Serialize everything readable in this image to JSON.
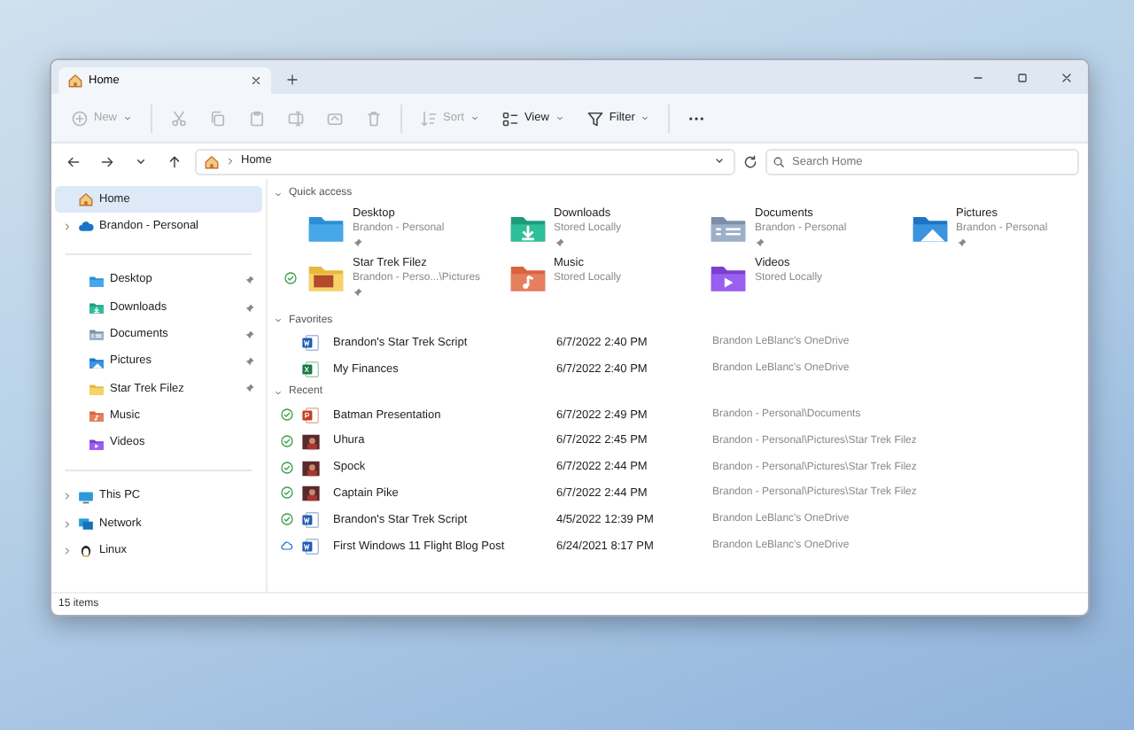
{
  "window": {
    "tab": {
      "title": "Home",
      "selected": true
    }
  },
  "toolbar": [
    {
      "label": "New",
      "kind": "new",
      "disabled": true
    },
    {
      "kind": "cut",
      "disabled": true
    },
    {
      "kind": "copy",
      "disabled": true
    },
    {
      "kind": "paste",
      "disabled": true
    },
    {
      "kind": "rename",
      "disabled": true
    },
    {
      "kind": "share",
      "disabled": true
    },
    {
      "kind": "delete",
      "disabled": true
    },
    {
      "label": "Sort",
      "kind": "sort",
      "disabled": true
    },
    {
      "label": "View",
      "kind": "view",
      "disabled": false
    },
    {
      "label": "Filter",
      "kind": "filter",
      "disabled": false
    },
    {
      "kind": "more",
      "disabled": false
    }
  ],
  "address": {
    "path": "Home",
    "search_placeholder": "Search Home"
  },
  "sidebar": {
    "top": [
      {
        "label": "Home",
        "kind": "home",
        "selected": true
      },
      {
        "label": "Brandon - Personal",
        "kind": "cloud",
        "selected": false,
        "expanded": false
      }
    ],
    "pinned": [
      {
        "label": "Desktop",
        "kind": "desktop",
        "pinned": true,
        "selected": false
      },
      {
        "label": "Downloads",
        "kind": "downloads",
        "pinned": true,
        "selected": false
      },
      {
        "label": "Documents",
        "kind": "documents",
        "pinned": true,
        "selected": false
      },
      {
        "label": "Pictures",
        "kind": "pictures",
        "pinned": true,
        "selected": false
      },
      {
        "label": "Star Trek Filez",
        "kind": "folder",
        "pinned": true,
        "selected": false
      },
      {
        "label": "Music",
        "kind": "music",
        "pinned": false,
        "selected": false
      },
      {
        "label": "Videos",
        "kind": "videos",
        "pinned": false,
        "selected": false
      }
    ],
    "devices": [
      {
        "label": "This PC",
        "kind": "pc",
        "expanded": false,
        "selected": false
      },
      {
        "label": "Network",
        "kind": "network",
        "expanded": false,
        "selected": false
      },
      {
        "label": "Linux",
        "kind": "linux",
        "expanded": false,
        "selected": false
      }
    ]
  },
  "quick_access": {
    "title": "Quick access",
    "expanded": true,
    "items": [
      {
        "name": "Desktop",
        "location": "Brandon - Personal",
        "kind": "desktop",
        "pinned": true,
        "synced": false,
        "online_only": false
      },
      {
        "name": "Downloads",
        "location": "Stored Locally",
        "kind": "downloads",
        "pinned": true,
        "synced": false,
        "online_only": false
      },
      {
        "name": "Documents",
        "location": "Brandon - Personal",
        "kind": "documents",
        "pinned": true,
        "synced": false,
        "online_only": false
      },
      {
        "name": "Pictures",
        "location": "Brandon - Personal",
        "kind": "pictures",
        "pinned": true,
        "synced": false,
        "online_only": false
      },
      {
        "name": "Star Trek Filez",
        "location": "Brandon - Perso...\\Pictures",
        "kind": "photos",
        "pinned": true,
        "synced": true,
        "online_only": false
      },
      {
        "name": "Music",
        "location": "Stored Locally",
        "kind": "music",
        "pinned": false,
        "synced": false,
        "online_only": false
      },
      {
        "name": "Videos",
        "location": "Stored Locally",
        "kind": "videos",
        "pinned": false,
        "synced": false,
        "online_only": false
      }
    ]
  },
  "favorites": {
    "title": "Favorites",
    "expanded": true,
    "rows": [
      {
        "name": "Brandon's Star Trek Script",
        "date": "6/7/2022 2:40 PM",
        "location": "Brandon LeBlanc's OneDrive",
        "kind": "word",
        "synced": false,
        "online_only": false
      },
      {
        "name": "My Finances",
        "date": "6/7/2022 2:40 PM",
        "location": "Brandon LeBlanc's OneDrive",
        "kind": "excel",
        "synced": false,
        "online_only": false
      }
    ]
  },
  "recent": {
    "title": "Recent",
    "expanded": true,
    "rows": [
      {
        "name": "Batman Presentation",
        "date": "6/7/2022 2:49 PM",
        "location": "Brandon - Personal\\Documents",
        "kind": "powerpoint",
        "synced": true,
        "online_only": false
      },
      {
        "name": "Uhura",
        "date": "6/7/2022 2:45 PM",
        "location": "Brandon - Personal\\Pictures\\Star Trek Filez",
        "kind": "photo",
        "synced": true,
        "online_only": false
      },
      {
        "name": "Spock",
        "date": "6/7/2022 2:44 PM",
        "location": "Brandon - Personal\\Pictures\\Star Trek Filez",
        "kind": "photo",
        "synced": true,
        "online_only": false
      },
      {
        "name": "Captain Pike",
        "date": "6/7/2022 2:44 PM",
        "location": "Brandon - Personal\\Pictures\\Star Trek Filez",
        "kind": "photo",
        "synced": true,
        "online_only": false
      },
      {
        "name": "Brandon's Star Trek Script",
        "date": "4/5/2022 12:39 PM",
        "location": "Brandon LeBlanc's OneDrive",
        "kind": "word",
        "synced": true,
        "online_only": false
      },
      {
        "name": "First Windows 11 Flight Blog Post",
        "date": "6/24/2021 8:17 PM",
        "location": "Brandon LeBlanc's OneDrive",
        "kind": "word",
        "synced": false,
        "online_only": true
      }
    ]
  },
  "status_bar": {
    "count": "15 items"
  }
}
